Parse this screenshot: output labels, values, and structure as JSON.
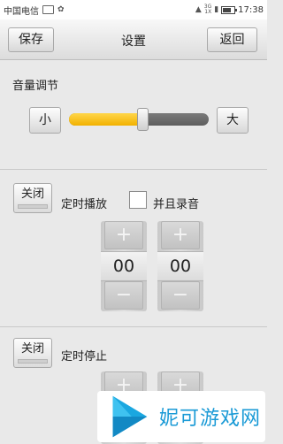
{
  "status_bar": {
    "carrier": "中国电信",
    "time": "17:38",
    "network_line1": "3G",
    "network_line2": "1X"
  },
  "header": {
    "save_label": "保存",
    "title": "设置",
    "back_label": "返回"
  },
  "volume": {
    "label": "音量调节",
    "decrease_label": "小",
    "increase_label": "大",
    "level_fraction": 0.53
  },
  "timed_play": {
    "toggle_label": "关闭",
    "label": "定时播放",
    "record_label": "并且录音",
    "record_checked": false,
    "hour_value": "00",
    "minute_value": "00",
    "plus": "+",
    "minus": "−"
  },
  "timed_stop": {
    "toggle_label": "关闭",
    "label": "定时停止",
    "plus": "+"
  },
  "watermark": {
    "text": "妮可游戏网"
  },
  "colors": {
    "slider_fill": "#f2b100",
    "watermark_text": "#1a9ad6"
  }
}
